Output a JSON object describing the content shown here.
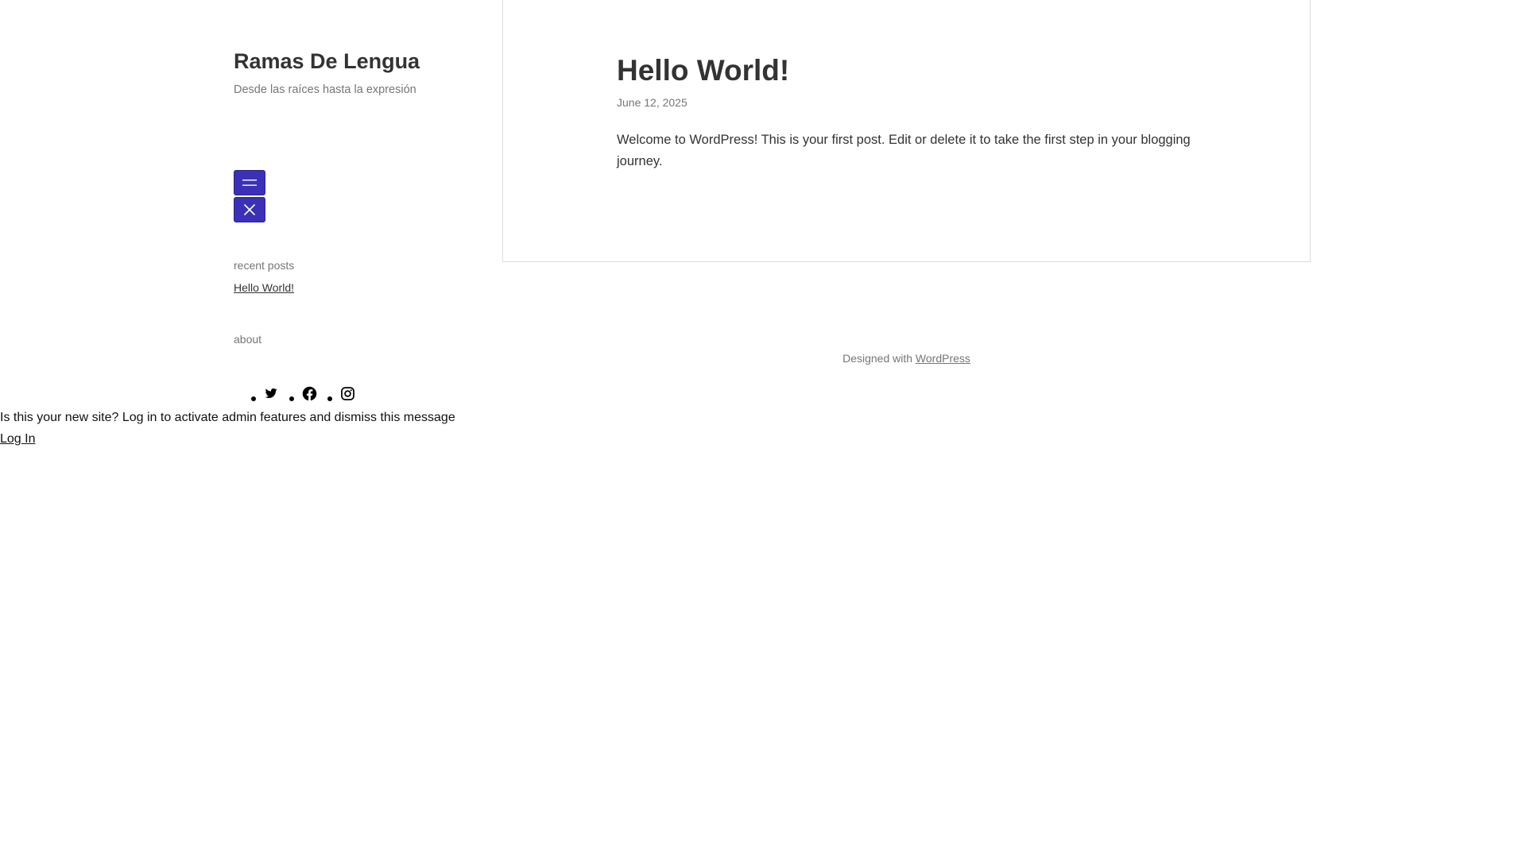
{
  "site": {
    "title": "Ramas De Lengua",
    "tagline": "Desde las raíces hasta la expresión"
  },
  "menu": {
    "open_icon": "hamburger-menu-icon",
    "close_icon": "close-icon"
  },
  "widgets": {
    "recent_posts_title": "recent posts",
    "recent_posts": [
      {
        "label": "Hello World!"
      }
    ],
    "about_title": "about"
  },
  "social": [
    {
      "icon": "twitter-icon"
    },
    {
      "icon": "facebook-icon"
    },
    {
      "icon": "instagram-icon"
    }
  ],
  "post": {
    "title": "Hello World!",
    "date": "June 12, 2025",
    "content": "Welcome to WordPress! This is your first post. Edit or delete it to take the first step in your blogging journey."
  },
  "footer": {
    "prefix": "Designed with",
    "link_label": "WordPress"
  },
  "admin": {
    "message": "Is this your new site? Log in to activate admin features and dismiss this message",
    "login_label": "Log In"
  },
  "colors": {
    "accent": "#3b31b7",
    "text": "#333333",
    "muted": "#767676",
    "border": "#dcdcdc"
  }
}
